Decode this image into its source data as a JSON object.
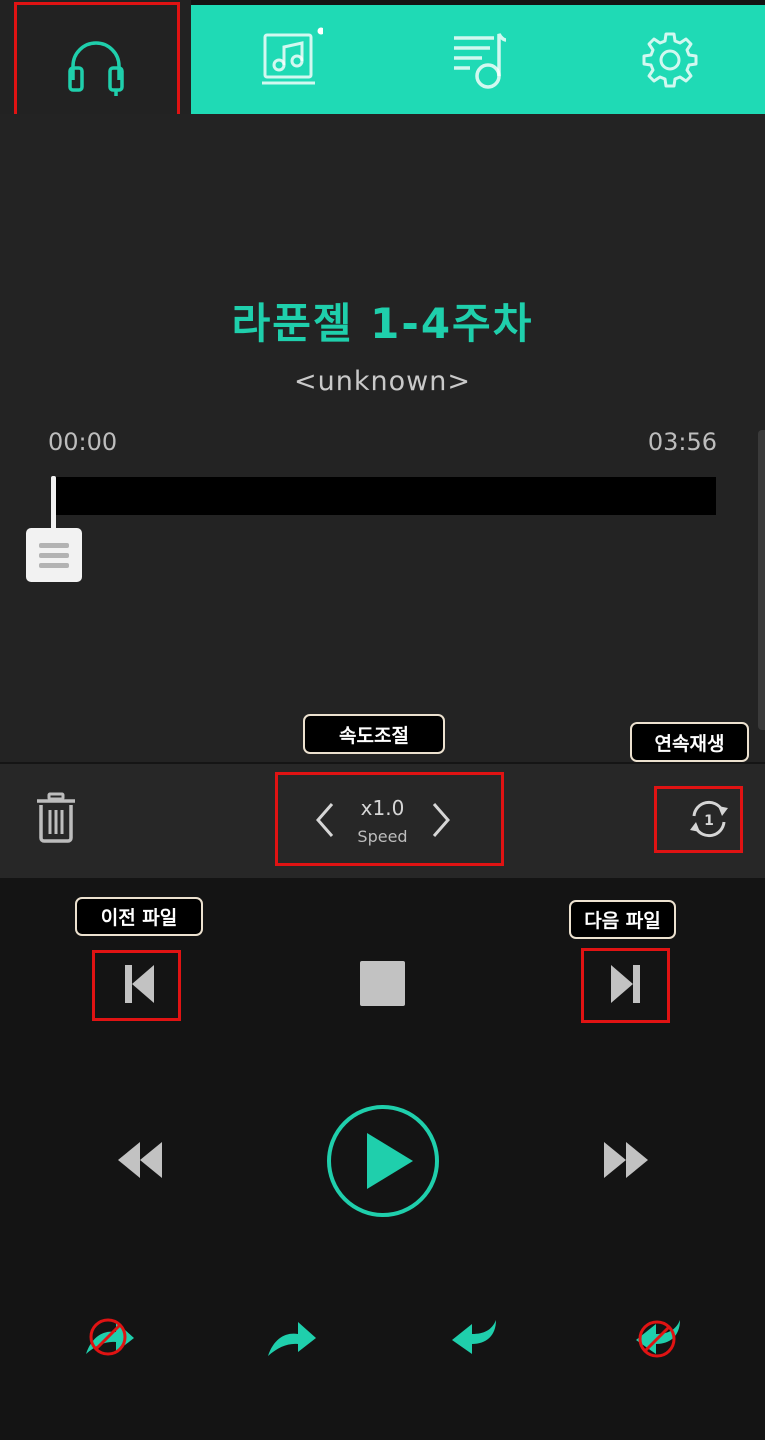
{
  "song": {
    "title": "라푼젤 1-4주차",
    "artist": "<unknown>",
    "current_time": "00:00",
    "total_time": "03:56",
    "progress": 0
  },
  "nav": {
    "tabs": [
      {
        "icon": "headphones-icon",
        "active": true
      },
      {
        "icon": "album-icon",
        "active": false
      },
      {
        "icon": "playlist-icon",
        "active": false
      },
      {
        "icon": "gear-icon",
        "active": false
      }
    ]
  },
  "controls": {
    "speed_value": "x1.0",
    "speed_label": "Speed"
  },
  "annotations": {
    "speed_control": "속도조절",
    "continuous_play": "연속재생",
    "previous_file": "이전 파일",
    "next_file": "다음 파일"
  },
  "colors": {
    "accent": "#1fdab5",
    "annotation_red": "#e01313",
    "background": "#232323"
  }
}
